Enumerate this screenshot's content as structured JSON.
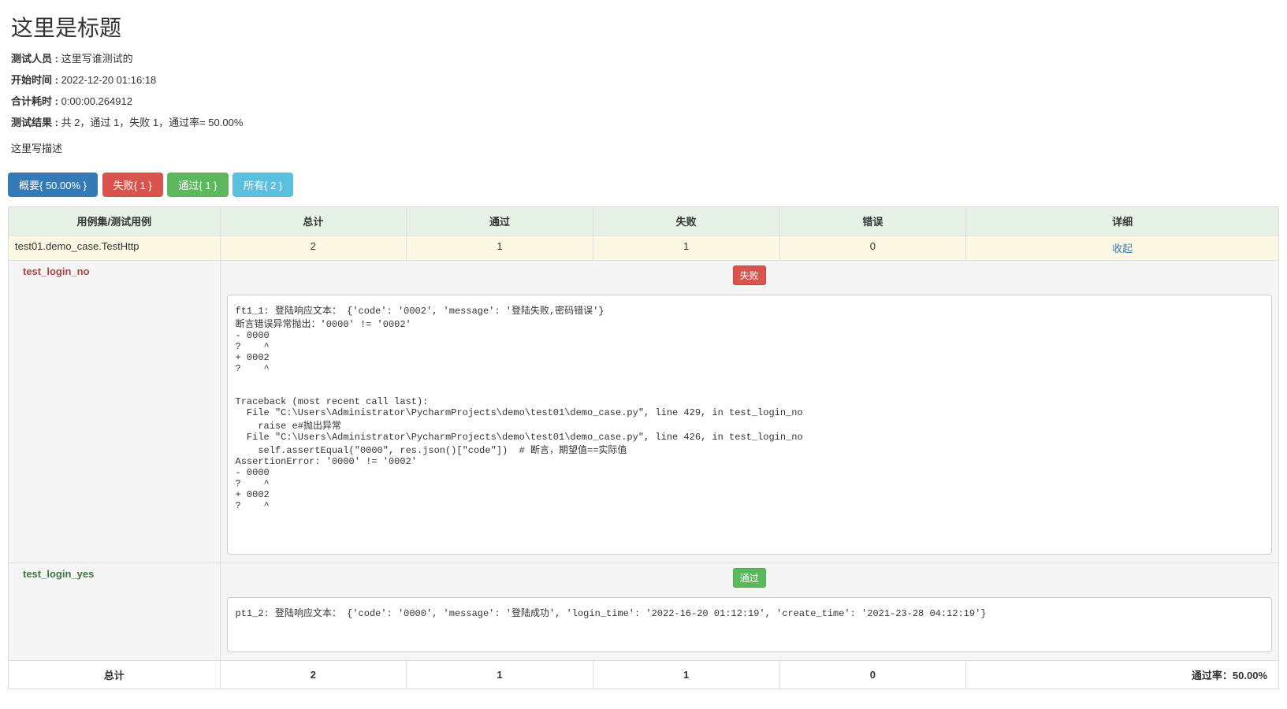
{
  "header": {
    "title": "这里是标题",
    "tester_label": "测试人员 :",
    "tester_value": " 这里写谁测试的",
    "start_label": "开始时间 :",
    "start_value": " 2022-12-20 01:16:18",
    "duration_label": "合计耗时 :",
    "duration_value": " 0:00:00.264912",
    "result_label": "测试结果 :",
    "result_value": " 共 2，通过 1，失败 1，通过率= 50.00%",
    "description": "这里写描述"
  },
  "buttons": {
    "summary": "概要{ 50.00% }",
    "fail": "失败{ 1 }",
    "pass": "通过{ 1 }",
    "all": "所有{ 2 }"
  },
  "columns": {
    "suite": "用例集/测试用例",
    "total": "总计",
    "pass": "通过",
    "fail": "失败",
    "error": "错误",
    "detail": "详细"
  },
  "suite": {
    "name": "test01.demo_case.TestHttp",
    "total": "2",
    "pass": "1",
    "fail": "1",
    "error": "0",
    "collapse": "收起"
  },
  "case1": {
    "name": "test_login_no",
    "badge": "失败",
    "trace": "ft1_1: 登陆响应文本： {'code': '0002', 'message': '登陆失败,密码错误'}\n断言错误异常抛出：'0000' != '0002'\n- 0000\n?    ^\n+ 0002\n?    ^\n\n\nTraceback (most recent call last):\n  File \"C:\\Users\\Administrator\\PycharmProjects\\demo\\test01\\demo_case.py\", line 429, in test_login_no\n    raise e#抛出异常\n  File \"C:\\Users\\Administrator\\PycharmProjects\\demo\\test01\\demo_case.py\", line 426, in test_login_no\n    self.assertEqual(\"0000\", res.json()[\"code\"])  # 断言，期望值==实际值\nAssertionError: '0000' != '0002'\n- 0000\n?    ^\n+ 0002\n?    ^"
  },
  "case2": {
    "name": "test_login_yes",
    "badge": "通过",
    "trace": "pt1_2: 登陆响应文本： {'code': '0000', 'message': '登陆成功', 'login_time': '2022-16-20 01:12:19', 'create_time': '2021-23-28 04:12:19'}"
  },
  "footer": {
    "total_label": "总计",
    "total": "2",
    "pass": "1",
    "fail": "1",
    "error": "0",
    "rate_label": "通过率：",
    "rate_value": "50.00%"
  }
}
